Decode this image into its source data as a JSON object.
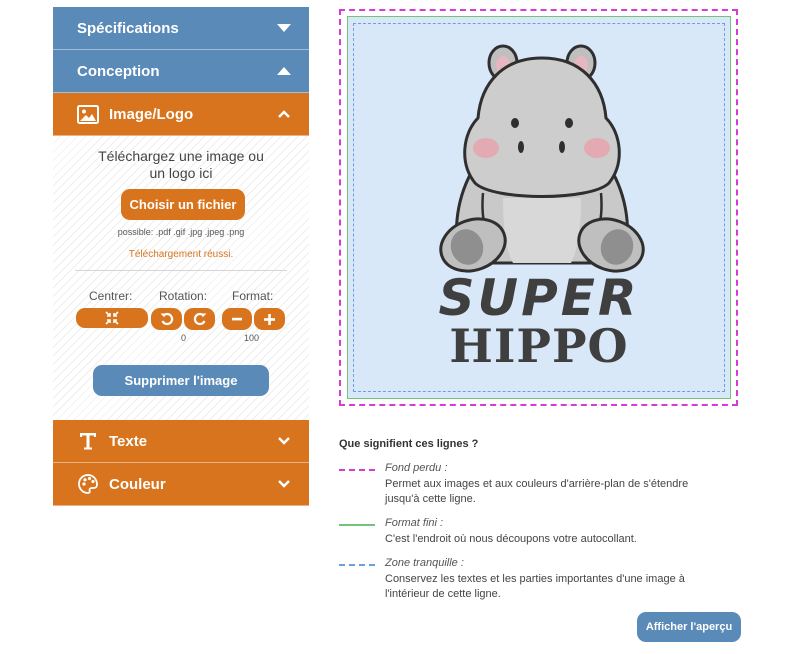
{
  "accordion": {
    "specifications": {
      "label": "Spécifications"
    },
    "design": {
      "label": "Conception"
    },
    "image": {
      "label": "Image/Logo",
      "upload_line1": "Téléchargez une image ou",
      "upload_line2": "un logo ici",
      "choose_file_label": "Choisir un fichier",
      "formats": "possible: .pdf .gif .jpg .jpeg .png",
      "status": "Téléchargement réussi.",
      "center_label": "Centrer:",
      "rotation_label": "Rotation:",
      "format_label": "Format:",
      "rotation_value": "0",
      "format_value": "100",
      "delete_label": "Supprimer l'image"
    },
    "text": {
      "label": "Texte"
    },
    "color": {
      "label": "Couleur"
    }
  },
  "preview": {
    "artwork_line1": "SUPER",
    "artwork_line2": "HIPPO"
  },
  "legend": {
    "title": "Que signifient ces lignes ?",
    "bleed": {
      "name": "Fond perdu :",
      "line1": "Permet aux images et aux couleurs d'arrière-plan de s'étendre",
      "line2": "jusqu'à cette ligne.",
      "color": "#d63bd6"
    },
    "finish": {
      "name": "Format fini :",
      "line1": "C'est l'endroit où nous découpons votre autocollant.",
      "color": "#77c27a"
    },
    "quiet": {
      "name": "Zone tranquille :",
      "line1": "Conservez les textes et les parties importantes d'une image à",
      "line2": "l'intérieur de cette ligne.",
      "color": "#6d9ee0"
    }
  },
  "preview_button_label": "Afficher l'aperçu",
  "colors": {
    "blue": "#5a8ab8",
    "orange": "#d8741d"
  },
  "icons": [
    "caret-down-icon",
    "caret-up-icon",
    "image-icon",
    "chevron-up-icon",
    "center-icon",
    "rotate-left-icon",
    "rotate-right-icon",
    "minus-icon",
    "plus-icon",
    "text-icon",
    "palette-icon",
    "chevron-down-icon"
  ]
}
